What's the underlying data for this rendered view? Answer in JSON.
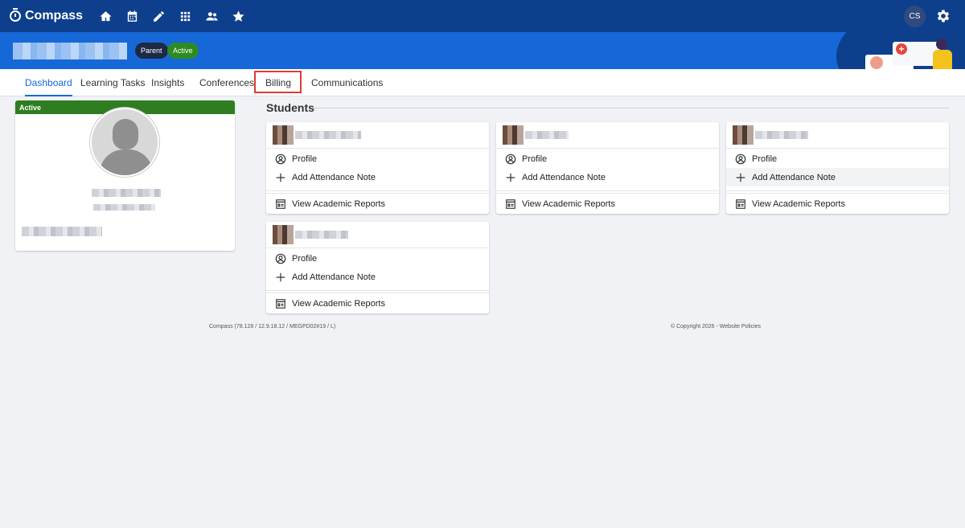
{
  "app": {
    "name": "Compass"
  },
  "nav_icons": [
    "home-icon",
    "calendar-icon",
    "pencil-icon",
    "apps-grid-icon",
    "people-icon",
    "star-icon"
  ],
  "user": {
    "initials": "CS"
  },
  "banner": {
    "badges": {
      "role": "Parent",
      "status": "Active"
    }
  },
  "tabs": [
    {
      "label": "Dashboard",
      "active": true
    },
    {
      "label": "Learning Tasks"
    },
    {
      "label": "Insights"
    },
    {
      "label": "Conferences"
    },
    {
      "label": "Billing",
      "highlighted": true
    },
    {
      "label": "Communications"
    }
  ],
  "profile": {
    "status": "Active"
  },
  "students": {
    "title": "Students",
    "cards": [
      {
        "profile": "Profile",
        "attendance": "Add Attendance Note",
        "reports": "View Academic Reports"
      },
      {
        "profile": "Profile",
        "attendance": "Add Attendance Note",
        "reports": "View Academic Reports"
      },
      {
        "profile": "Profile",
        "attendance": "Add Attendance Note",
        "reports": "View Academic Reports"
      },
      {
        "profile": "Profile",
        "attendance": "Add Attendance Note",
        "reports": "View Academic Reports"
      }
    ]
  },
  "footer": {
    "version": "Compass (78.128 / 12.9.18.12 / MEGPD02#19 / L)",
    "copyright": "© Copyright 2026 - Website Policies"
  },
  "colors": {
    "topbar": "#0d3f8c",
    "banner": "#1668d8",
    "active_green": "#2e7d21",
    "highlight_red": "#e03a2f"
  }
}
